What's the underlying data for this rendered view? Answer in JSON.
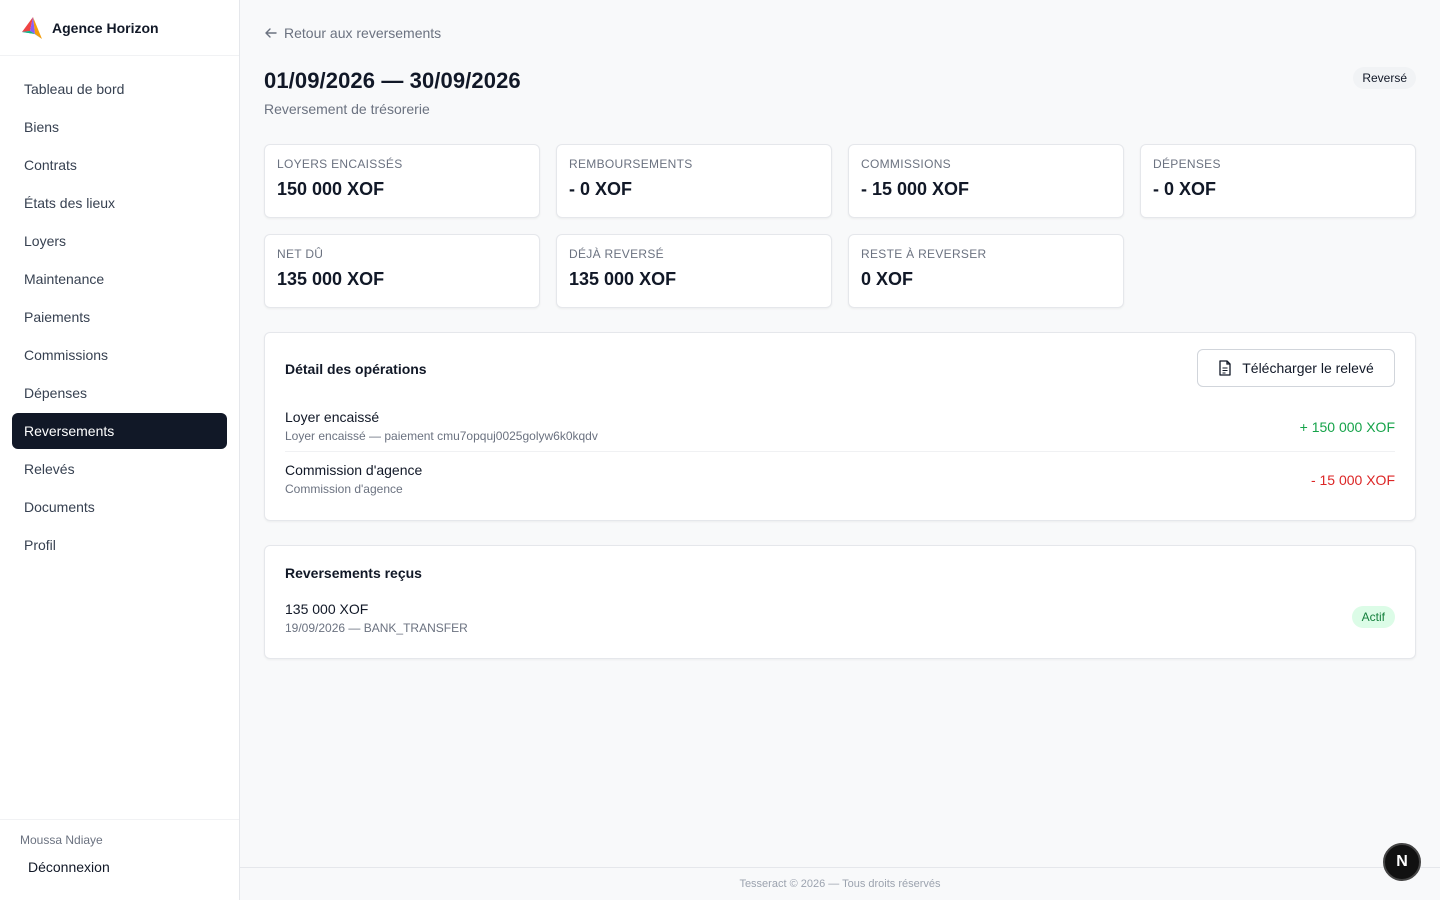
{
  "brand": {
    "name": "Agence Horizon"
  },
  "sidebar": {
    "items": [
      {
        "label": "Tableau de bord"
      },
      {
        "label": "Biens"
      },
      {
        "label": "Contrats"
      },
      {
        "label": "États des lieux"
      },
      {
        "label": "Loyers"
      },
      {
        "label": "Maintenance"
      },
      {
        "label": "Paiements"
      },
      {
        "label": "Commissions"
      },
      {
        "label": "Dépenses"
      },
      {
        "label": "Reversements",
        "active": true
      },
      {
        "label": "Relevés"
      },
      {
        "label": "Documents"
      },
      {
        "label": "Profil"
      }
    ],
    "user_name": "Moussa Ndiaye",
    "logout_label": "Déconnexion"
  },
  "header": {
    "back_label": "Retour aux reversements",
    "title": "01/09/2026 — 30/09/2026",
    "subtitle": "Reversement de trésorerie",
    "status": "Reversé"
  },
  "summary_cards": [
    {
      "label": "LOYERS ENCAISSÉS",
      "value": "150 000 XOF"
    },
    {
      "label": "REMBOURSEMENTS",
      "value": "- 0 XOF"
    },
    {
      "label": "COMMISSIONS",
      "value": "- 15 000 XOF"
    },
    {
      "label": "DÉPENSES",
      "value": "- 0 XOF"
    },
    {
      "label": "NET DÛ",
      "value": "135 000 XOF"
    },
    {
      "label": "DÉJÀ REVERSÉ",
      "value": "135 000 XOF"
    },
    {
      "label": "RESTE À REVERSER",
      "value": "0 XOF"
    }
  ],
  "operations": {
    "title": "Détail des opérations",
    "download_label": "Télécharger le relevé",
    "rows": [
      {
        "title": "Loyer encaissé",
        "subtitle": "Loyer encaissé — paiement cmu7opquj0025golyw6k0kqdv",
        "amount": "+ 150 000 XOF",
        "color": "#16a34a"
      },
      {
        "title": "Commission d'agence",
        "subtitle": "Commission d'agence",
        "amount": "- 15 000 XOF",
        "color": "#dc2626"
      }
    ]
  },
  "payouts": {
    "title": "Reversements reçus",
    "rows": [
      {
        "amount": "135 000 XOF",
        "details": "19/09/2026 — BANK_TRANSFER",
        "status": "Actif"
      }
    ]
  },
  "footer": {
    "text": "Tesseract © 2026 — Tous droits réservés"
  },
  "dev_badge": {
    "label": "N"
  }
}
